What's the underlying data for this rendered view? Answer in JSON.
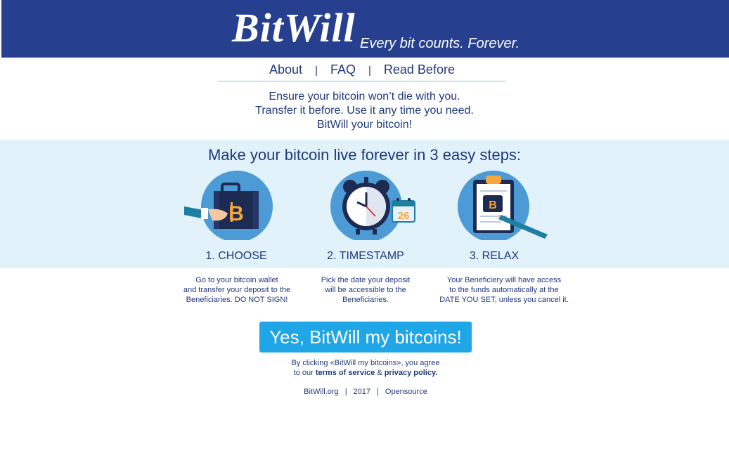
{
  "header": {
    "logo_text": "BitWill",
    "tagline": "Every bit counts. Forever."
  },
  "nav": {
    "items": [
      {
        "label": "About"
      },
      {
        "label": "FAQ"
      },
      {
        "label": "Read Before"
      }
    ],
    "separator": "|"
  },
  "intro": {
    "lines": [
      "Ensure your bitcoin won’t die with you.",
      "Transfer it before. Use it any time you need.",
      "BitWill your bitcoin!"
    ]
  },
  "steps_section": {
    "title": "Make your bitcoin live forever in 3 easy steps:",
    "steps": [
      {
        "label": "1. CHOOSE",
        "icon": "bitcoin-briefcase-icon",
        "desc_lines": [
          "Go to your bitcoin wallet",
          "and transfer your deposit to the",
          "Beneficiaries. DO NOT SIGN!"
        ]
      },
      {
        "label": "2. TIMESTAMP",
        "icon": "alarm-clock-calendar-icon",
        "calendar_day": "26",
        "desc_lines": [
          "Pick the date your deposit",
          "will be accessible to the",
          "Beneficiaries."
        ]
      },
      {
        "label": "3. RELAX",
        "icon": "clipboard-document-icon",
        "desc_lines": [
          "Your Beneficiery will have access",
          "to the funds automatically at the",
          "DATE YOU SET, unless you cancel it."
        ]
      }
    ]
  },
  "cta": {
    "label": "Yes, BitWill my bitcoins!"
  },
  "agreement": {
    "line1": "By clicking «BitWill my bitcoins», you agree",
    "prefix": "to our ",
    "terms": "terms of service",
    "amp": " & ",
    "privacy": "privacy policy."
  },
  "footer": {
    "site": "BitWill.org",
    "year": "2017",
    "opensource": "Opensource",
    "separator": "|"
  },
  "colors": {
    "header_bg": "#263f8f",
    "band_bg": "#e1f2fb",
    "cta_bg": "#1ea6e6",
    "text": "#1f3a7a",
    "icon_circle": "#4d9bd6",
    "bitcoin_orange": "#f4a73a"
  }
}
